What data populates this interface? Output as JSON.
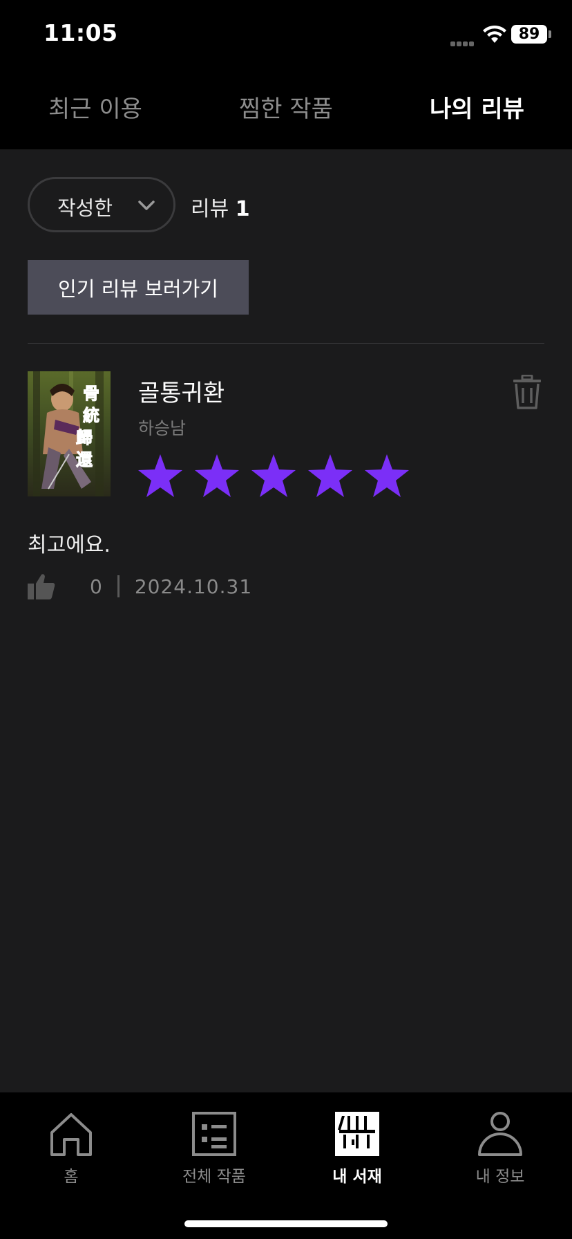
{
  "status_bar": {
    "time": "11:05",
    "battery": "89"
  },
  "top_tabs": [
    {
      "label": "최근 이용",
      "active": false
    },
    {
      "label": "찜한 작품",
      "active": false
    },
    {
      "label": "나의 리뷰",
      "active": true
    }
  ],
  "filter": {
    "selected": "작성한",
    "review_label": "리뷰",
    "review_count": "1"
  },
  "popular_reviews_button": "인기 리뷰 보러가기",
  "review": {
    "title": "골통귀환",
    "author": "하승남",
    "rating": 5,
    "max_rating": 5,
    "text": "최고에요.",
    "likes": "0",
    "date": "2024.10.31",
    "cover_text": "骨統歸還"
  },
  "bottom_nav": [
    {
      "label": "홈",
      "icon": "home-icon",
      "active": false
    },
    {
      "label": "전체 작품",
      "icon": "list-icon",
      "active": false
    },
    {
      "label": "내 서재",
      "icon": "library-icon",
      "active": true
    },
    {
      "label": "내 정보",
      "icon": "person-icon",
      "active": false
    }
  ],
  "colors": {
    "star": "#7b2ff7",
    "background": "#1b1b1c",
    "button": "#4c4c58"
  }
}
